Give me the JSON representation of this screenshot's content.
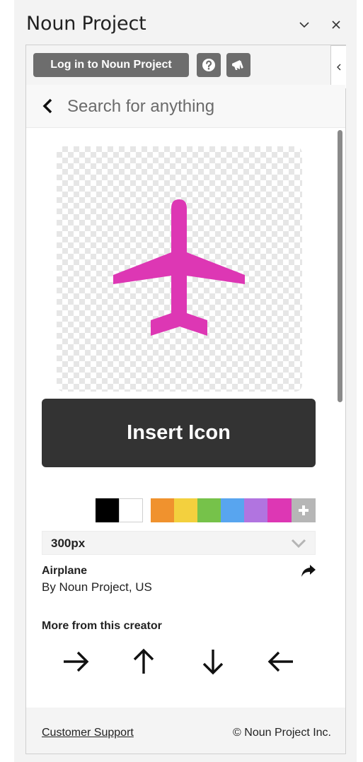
{
  "pane": {
    "title": "Noun Project"
  },
  "toolbar": {
    "login_label": "Log in to Noun Project"
  },
  "search": {
    "placeholder": "Search for anything"
  },
  "preview": {
    "icon": "airplane-icon",
    "icon_color": "#dd37b4"
  },
  "actions": {
    "insert_label": "Insert Icon"
  },
  "colors": {
    "base": [
      "#000000",
      "#ffffff"
    ],
    "palette": [
      "#f0922e",
      "#f3d03e",
      "#76c24a",
      "#58a5ef",
      "#b174e0",
      "#dd37b4"
    ],
    "add_icon": "plus-icon"
  },
  "size": {
    "selected": "300px"
  },
  "details": {
    "name": "Airplane",
    "creator": "By Noun Project, US"
  },
  "more": {
    "title": "More from this creator",
    "icons": [
      "arrow-right-icon",
      "arrow-up-icon",
      "arrow-down-icon",
      "arrow-left-icon"
    ]
  },
  "footer": {
    "support": "Customer Support",
    "copyright": "© Noun Project Inc."
  }
}
